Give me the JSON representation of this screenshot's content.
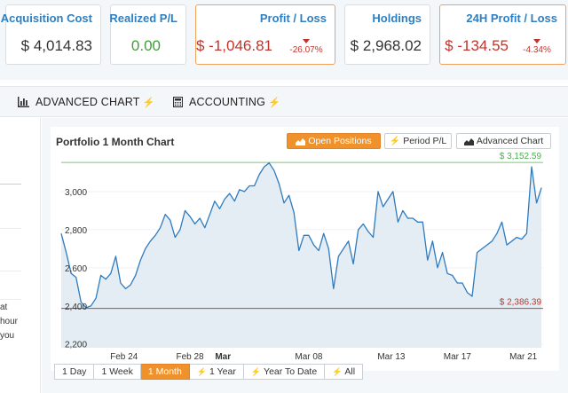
{
  "stats": [
    {
      "title": "Acquisition Cost",
      "value": "$ 4,014.83",
      "tone": "dark"
    },
    {
      "title": "Realized P/L",
      "value": "0.00",
      "tone": "green"
    },
    {
      "title": "Profit / Loss",
      "value": "$ -1,046.81",
      "tone": "red",
      "change": "-26.07%"
    },
    {
      "title": "Holdings",
      "value": "$ 2,968.02",
      "tone": "dark"
    },
    {
      "title": "24H Profit / Loss",
      "value": "$ -134.55",
      "tone": "red",
      "change": "-4.34%"
    }
  ],
  "tabs": {
    "advanced_chart": "ADVANCED CHART",
    "accounting": "ACCOUNTING"
  },
  "left_text": [
    "at",
    "hour",
    "you"
  ],
  "chart": {
    "title": "Portfolio 1 Month Chart",
    "buttons": {
      "open_positions": "Open Positions",
      "period_pl": "Period P/L",
      "advanced_chart": "Advanced Chart"
    },
    "active_button": "open_positions",
    "ranges": [
      "1 Day",
      "1 Week",
      "1 Month",
      "1 Year",
      "Year To Date",
      "All"
    ],
    "active_range": "1 Month",
    "colors": {
      "accent": "#f0922b",
      "line": "#2e7bbf",
      "area": "#e4edf3",
      "max_line": "#7cc576",
      "min_line": "#a0504b",
      "max_label": "#4caf50",
      "min_label": "#c0342c"
    }
  },
  "chart_data": {
    "type": "area",
    "title": "Portfolio 1 Month Chart",
    "xlabel": "",
    "ylabel": "",
    "ylim": [
      2180,
      3200
    ],
    "yticks": [
      2200,
      2400,
      2600,
      2800,
      3000
    ],
    "ytick_labels": [
      "2,200",
      "2,400",
      "2,600",
      "2,800",
      "3,000"
    ],
    "xlim": [
      0,
      29.2
    ],
    "xticks": [
      {
        "x": 3.8,
        "label": "Feb 24",
        "bold": false
      },
      {
        "x": 7.8,
        "label": "Feb 28",
        "bold": false
      },
      {
        "x": 9.8,
        "label": "Mar",
        "bold": true
      },
      {
        "x": 15.0,
        "label": "Mar 08",
        "bold": false
      },
      {
        "x": 20.0,
        "label": "Mar 13",
        "bold": false
      },
      {
        "x": 24.0,
        "label": "Mar 17",
        "bold": false
      },
      {
        "x": 28.0,
        "label": "Mar 21",
        "bold": false
      }
    ],
    "max": {
      "value": 3152.59,
      "label": "$ 3,152.59"
    },
    "min": {
      "value": 2386.39,
      "label": "$ 2,386.39"
    },
    "x": [
      0,
      0.3,
      0.6,
      0.9,
      1.2,
      1.5,
      1.8,
      2.1,
      2.4,
      2.7,
      3.0,
      3.3,
      3.6,
      3.9,
      4.2,
      4.5,
      4.8,
      5.1,
      5.4,
      5.7,
      6.0,
      6.3,
      6.6,
      6.9,
      7.2,
      7.5,
      7.8,
      8.1,
      8.4,
      8.7,
      9.0,
      9.3,
      9.6,
      9.9,
      10.2,
      10.5,
      10.8,
      11.1,
      11.4,
      11.7,
      12.0,
      12.3,
      12.6,
      12.9,
      13.2,
      13.5,
      13.8,
      14.1,
      14.4,
      14.7,
      15.0,
      15.3,
      15.6,
      15.9,
      16.2,
      16.5,
      16.8,
      17.1,
      17.4,
      17.7,
      18.0,
      18.3,
      18.6,
      18.9,
      19.2,
      19.5,
      19.8,
      20.1,
      20.4,
      20.7,
      21.0,
      21.3,
      21.6,
      21.9,
      22.2,
      22.5,
      22.8,
      23.1,
      23.4,
      23.7,
      24.0,
      24.3,
      24.6,
      24.9,
      25.2,
      25.5,
      25.8,
      26.1,
      26.4,
      26.7,
      27.0,
      27.3,
      27.6,
      27.9,
      28.2,
      28.5,
      28.8,
      29.1
    ],
    "y": [
      2780,
      2680,
      2570,
      2550,
      2420,
      2390,
      2400,
      2440,
      2560,
      2540,
      2570,
      2660,
      2520,
      2490,
      2510,
      2560,
      2640,
      2700,
      2740,
      2770,
      2810,
      2880,
      2850,
      2760,
      2800,
      2900,
      2870,
      2830,
      2860,
      2810,
      2880,
      2950,
      2910,
      2960,
      2990,
      2950,
      3010,
      3000,
      3030,
      3030,
      3090,
      3130,
      3150,
      3110,
      3040,
      2940,
      2980,
      2890,
      2690,
      2770,
      2770,
      2720,
      2690,
      2780,
      2700,
      2490,
      2660,
      2700,
      2740,
      2620,
      2800,
      2830,
      2790,
      2760,
      3000,
      2920,
      2960,
      3000,
      2840,
      2900,
      2860,
      2860,
      2840,
      2840,
      2640,
      2740,
      2600,
      2680,
      2570,
      2560,
      2520,
      2520,
      2470,
      2450,
      2680,
      2700,
      2720,
      2740,
      2780,
      2840,
      2720,
      2740,
      2760,
      2750,
      2780,
      3130,
      2940,
      3020
    ]
  }
}
